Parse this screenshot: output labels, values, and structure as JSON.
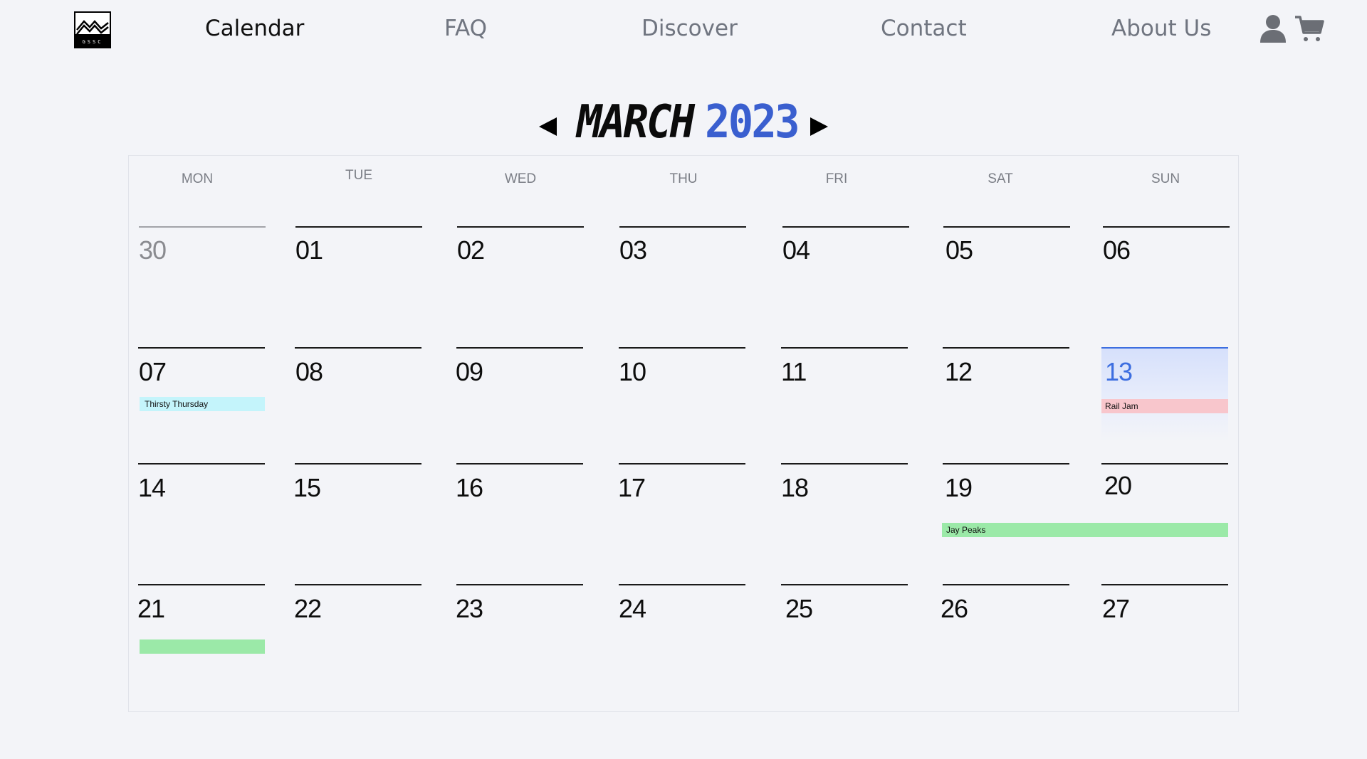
{
  "nav": {
    "logo_text": "GSSC",
    "links": [
      "Calendar",
      "FAQ",
      "Discover",
      "Contact",
      "About Us"
    ],
    "active": "Calendar"
  },
  "icons": {
    "user": "user-icon",
    "cart": "cart-icon",
    "prev": "triangle-left-icon",
    "next": "triangle-right-icon"
  },
  "header": {
    "month": "MARCH",
    "year": "2023"
  },
  "colors": {
    "accent": "#3d6ee0",
    "background": "#f3f4f8",
    "event_cyan": "#c4f4fb",
    "event_pink": "#f8c6cc",
    "event_green": "#9be9a8"
  },
  "calendar": {
    "weekdays": [
      "MON",
      "TUE",
      "WED",
      "THU",
      "FRI",
      "SAT",
      "SUN"
    ],
    "weeks": [
      [
        "30",
        "01",
        "02",
        "03",
        "04",
        "05",
        "06"
      ],
      [
        "07",
        "08",
        "09",
        "10",
        "11",
        "12",
        "13"
      ],
      [
        "14",
        "15",
        "16",
        "17",
        "18",
        "19",
        "20"
      ],
      [
        "21",
        "22",
        "23",
        "24",
        "25",
        "26",
        "27"
      ]
    ],
    "today": "13",
    "events": [
      {
        "label": "Thirsty Thursday",
        "date": "07"
      },
      {
        "label": "Rail Jam",
        "date": "13"
      },
      {
        "label": "Jay Peaks",
        "date": "19",
        "end": "20"
      },
      {
        "label": "",
        "date": "21"
      }
    ]
  }
}
